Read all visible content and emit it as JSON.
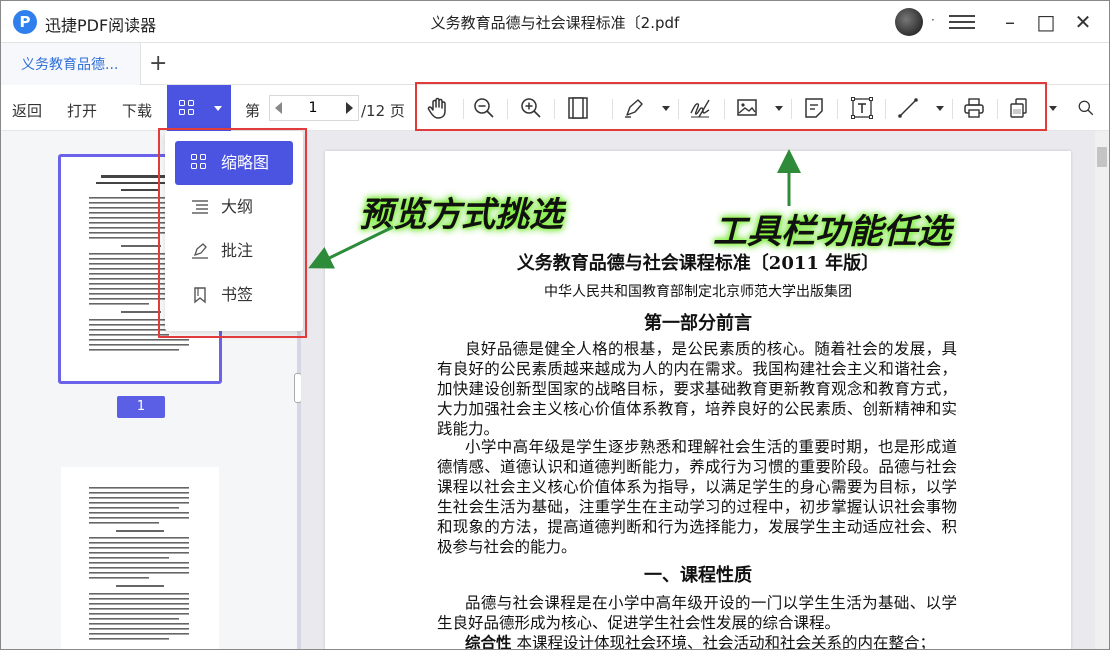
{
  "app": {
    "name": "迅捷PDF阅读器",
    "logo_letter": "P",
    "doc_title": "义务教育品德与社会课程标准〔2.pdf",
    "more_dot": "·"
  },
  "window": {
    "minimize": "–",
    "maximize": "□",
    "close": "✕"
  },
  "tabs": [
    {
      "label": "义务教育品德..."
    }
  ],
  "tab_add": "+",
  "toolbar": {
    "back": "返回",
    "open": "打开",
    "download": "下载",
    "page_prefix": "第",
    "page_value": "1",
    "page_total": "/12 页"
  },
  "view_menu": {
    "items": [
      {
        "label": "缩略图",
        "selected": true
      },
      {
        "label": "大纲"
      },
      {
        "label": "批注"
      },
      {
        "label": "书签"
      }
    ]
  },
  "thumbnail": {
    "page_number": "1"
  },
  "annotations": {
    "left": "预览方式挑选",
    "right": "工具栏功能任选"
  },
  "document": {
    "title": "义务教育品德与社会课程标准〔2011 年版〕",
    "publisher": "中华人民共和国教育部制定北京师范大学出版集团",
    "part_heading": "第一部分前言",
    "para1": "良好品德是健全人格的根基，是公民素质的核心。随着社会的发展，具有良好的公民素质越来越成为人的内在需求。我国构建社会主义和谐社会，加快建设创新型国家的战略目标，要求基础教育更新教育观念和教育方式，大力加强社会主义核心价值体系教育，培养良好的公民素质、创新精神和实践能力。",
    "para2": "小学中高年级是学生逐步熟悉和理解社会生活的重要时期，也是形成道德情感、道德认识和道德判断能力，养成行为习惯的重要阶段。品德与社会课程以社会主义核心价值体系为指导，以满足学生的身心需要为目标，以学生社会生活为基础，注重学生在主动学习的过程中，初步掌握认识社会事物和现象的方法，提高道德判断和行为选择能力，发展学生主动适应社会、积极参与社会的能力。",
    "section_heading": "一、课程性质",
    "para3": "品德与社会课程是在小学中高年级开设的一门以学生生活为基础、以学生良好品德形成为核心、促进学生社会性发展的综合课程。",
    "para4_bold": "综合性",
    "para4": "本课程设计体现社会环境、社会活动和社会关系的内在整合；"
  },
  "colors": {
    "accent": "#4a54e1",
    "highlight_box": "#e23b3b",
    "annotation_glow": "#6ff02a",
    "arrow": "#2e8b3a"
  }
}
